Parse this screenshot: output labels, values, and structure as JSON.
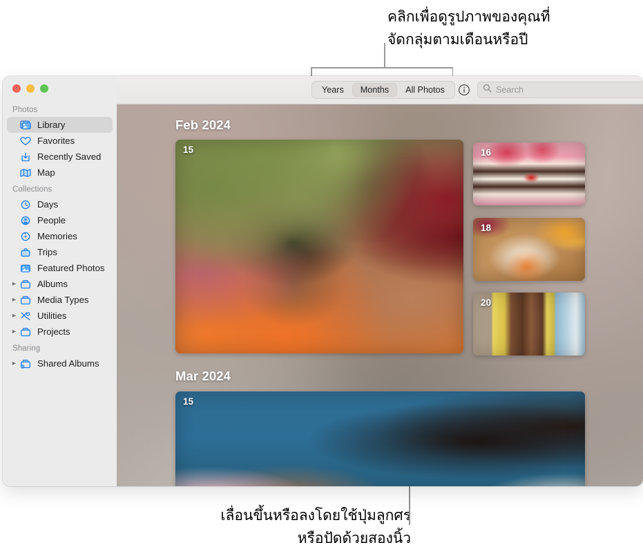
{
  "annotations": {
    "top_callout": "คลิกเพื่อดูรูปภาพของคุณที่\nจัดกลุ่มตามเดือนหรือปี",
    "bottom_callout": "เลื่อนขึ้นหรือลงโดยใช้ปุ่มลูกศร\nหรือปัดด้วยสองนิ้ว"
  },
  "window": {
    "traffic_lights": {
      "close": "close-button",
      "minimize": "minimize-button",
      "zoom": "zoom-button"
    }
  },
  "sidebar": {
    "groups": [
      {
        "label": "Photos",
        "items": [
          {
            "label": "Library",
            "icon": "library-icon",
            "selected": true,
            "disclosure": false
          },
          {
            "label": "Favorites",
            "icon": "heart-icon",
            "selected": false,
            "disclosure": false
          },
          {
            "label": "Recently Saved",
            "icon": "recently-saved-icon",
            "selected": false,
            "disclosure": false
          },
          {
            "label": "Map",
            "icon": "map-icon",
            "selected": false,
            "disclosure": false
          }
        ]
      },
      {
        "label": "Collections",
        "items": [
          {
            "label": "Days",
            "icon": "clock-icon",
            "selected": false,
            "disclosure": false
          },
          {
            "label": "People",
            "icon": "person-icon",
            "selected": false,
            "disclosure": false
          },
          {
            "label": "Memories",
            "icon": "memories-icon",
            "selected": false,
            "disclosure": false
          },
          {
            "label": "Trips",
            "icon": "trips-icon",
            "selected": false,
            "disclosure": false
          },
          {
            "label": "Featured Photos",
            "icon": "featured-photos-icon",
            "selected": false,
            "disclosure": false
          },
          {
            "label": "Albums",
            "icon": "album-icon",
            "selected": false,
            "disclosure": true
          },
          {
            "label": "Media Types",
            "icon": "album-icon",
            "selected": false,
            "disclosure": true
          },
          {
            "label": "Utilities",
            "icon": "utilities-icon",
            "selected": false,
            "disclosure": true
          },
          {
            "label": "Projects",
            "icon": "album-icon",
            "selected": false,
            "disclosure": true
          }
        ]
      },
      {
        "label": "Sharing",
        "items": [
          {
            "label": "Shared Albums",
            "icon": "shared-album-icon",
            "selected": false,
            "disclosure": true
          }
        ]
      }
    ]
  },
  "toolbar": {
    "segments": [
      {
        "label": "Years",
        "selected": false
      },
      {
        "label": "Months",
        "selected": true
      },
      {
        "label": "All Photos",
        "selected": false
      }
    ],
    "info_button": "info-button",
    "search": {
      "placeholder": "Search",
      "value": ""
    }
  },
  "grid": {
    "sections": [
      {
        "title": "Feb 2024",
        "hero": {
          "day": "15",
          "description": "group selfie of four people smiling outdoors"
        },
        "thumbs": [
          {
            "day": "16",
            "description": "slice of pink layer cake with a cherry"
          },
          {
            "day": "18",
            "description": "plated roasted carrots and citrus on a wooden table"
          },
          {
            "day": "20",
            "description": "person with yellow scarf at the beach"
          }
        ]
      },
      {
        "title": "Mar 2024",
        "hero": {
          "day": "15",
          "description": "person with curly hair on a blue backdrop"
        },
        "thumbs": []
      }
    ]
  },
  "colors": {
    "accent": "#3b82f6",
    "sidebar_bg": "#ebebeb",
    "selected_row": "#d6d6d6",
    "traffic_red": "#f4645c",
    "traffic_yellow": "#fbbe3f",
    "traffic_green": "#60c453"
  }
}
